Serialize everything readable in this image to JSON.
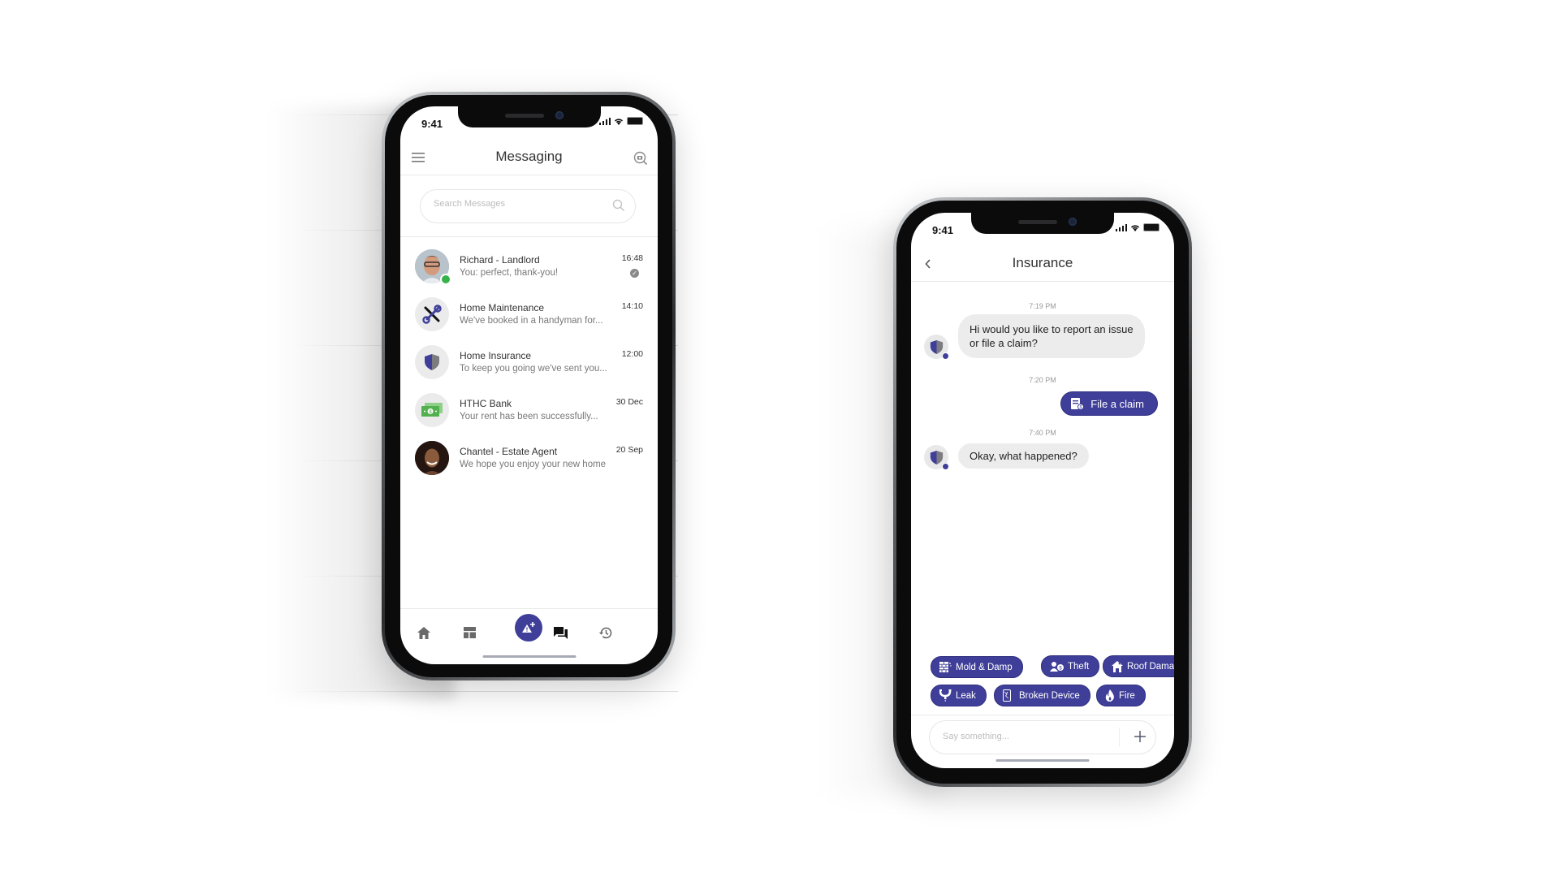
{
  "colors": {
    "accent": "#3f3f9a",
    "online": "#35b34a",
    "bubble": "#ececec"
  },
  "messaging_phone": {
    "status_time": "9:41",
    "header": {
      "title": "Messaging",
      "left_icon": "menu-icon",
      "right_icon": "camera-search-icon"
    },
    "search": {
      "placeholder": "Search Messages",
      "value": ""
    },
    "conversations": [
      {
        "name": "Richard - Landlord",
        "preview": "You: perfect, thank-you!",
        "time": "16:48",
        "avatar": "photo",
        "online": true,
        "read": true
      },
      {
        "name": "Home Maintenance",
        "preview": "We've booked in a handyman for...",
        "time": "14:10",
        "avatar": "tools-icon"
      },
      {
        "name": "Home Insurance",
        "preview": "To keep you going we've sent you...",
        "time": "12:00",
        "avatar": "shield-icon"
      },
      {
        "name": "HTHC Bank",
        "preview": "Your rent has been successfully...",
        "time": "30 Dec",
        "avatar": "cash-icon"
      },
      {
        "name": "Chantel - Estate Agent",
        "preview": "We hope you enjoy your new home",
        "time": "20 Sep",
        "avatar": "photo"
      }
    ],
    "tabbar": [
      "home-icon",
      "dashboard-icon",
      "report-issue-icon",
      "messages-icon",
      "history-icon"
    ],
    "active_tab": "messages-icon"
  },
  "insurance_phone": {
    "status_time": "9:41",
    "header": {
      "title": "Insurance",
      "back_icon": "chevron-left-icon"
    },
    "messages": [
      {
        "time": "7:19 PM",
        "from": "bot",
        "text": "Hi would you like to report an issue or file a claim?"
      },
      {
        "time": "7:20 PM",
        "from": "user",
        "text": "File a claim"
      },
      {
        "time": "7:40 PM",
        "from": "bot",
        "text": "Okay, what happened?"
      }
    ],
    "quick_replies_row1": [
      "Mold & Damp",
      "Theft",
      "Roof Damage"
    ],
    "quick_replies_row2": [
      "Leak",
      "Broken Device",
      "Fire"
    ],
    "composer": {
      "placeholder": "Say something...",
      "value": ""
    }
  }
}
